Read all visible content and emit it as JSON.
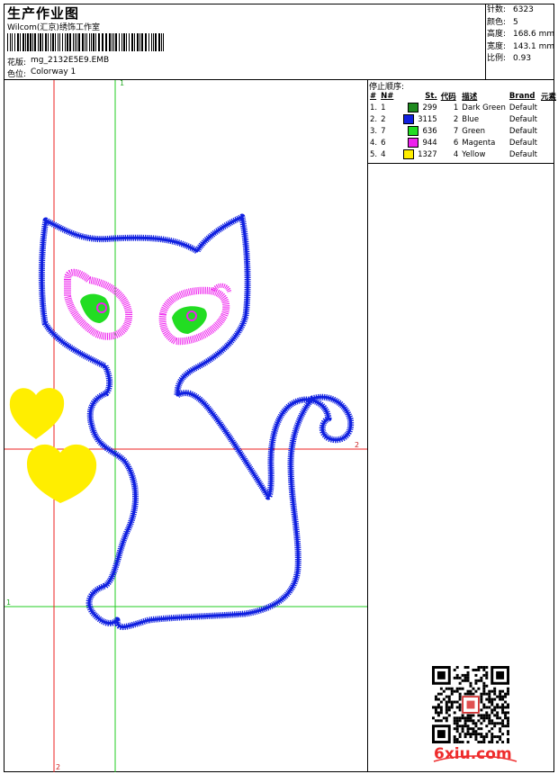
{
  "header": {
    "title": "生产作业图",
    "company": "Wilcom(汇京)绣饰工作室",
    "pattern_label": "花版:",
    "pattern_value": "mg_2132E5E9.EMB",
    "colorway_label": "色位:",
    "colorway_value": "Colorway 1"
  },
  "stats": {
    "stitches_label": "针数:",
    "stitches_value": "6323",
    "colors_label": "颜色:",
    "colors_value": "5",
    "height_label": "高度:",
    "height_value": "168.6 mm",
    "width_label": "宽度:",
    "width_value": "143.1 mm",
    "scale_label": "比例:",
    "scale_value": "0.93"
  },
  "stop_sequence": {
    "title": "停止顺序:",
    "headers": [
      "#",
      "N#",
      "St.",
      "代码",
      "描述",
      "Brand",
      "元素"
    ],
    "rows": [
      {
        "idx": "1.",
        "n": "1",
        "color": "#1f8a1f",
        "st": "299",
        "code": "1",
        "desc": "Dark Green",
        "brand": "Default"
      },
      {
        "idx": "2.",
        "n": "2",
        "color": "#1020e0",
        "st": "3115",
        "code": "2",
        "desc": "Blue",
        "brand": "Default"
      },
      {
        "idx": "3.",
        "n": "7",
        "color": "#22dd22",
        "st": "636",
        "code": "7",
        "desc": "Green",
        "brand": "Default"
      },
      {
        "idx": "4.",
        "n": "6",
        "color": "#ee22ee",
        "st": "944",
        "code": "6",
        "desc": "Magenta",
        "brand": "Default"
      },
      {
        "idx": "5.",
        "n": "4",
        "color": "#ffee00",
        "st": "1327",
        "code": "4",
        "desc": "Yellow",
        "brand": "Default"
      }
    ]
  },
  "canvas": {
    "marker_top": "1",
    "marker_left": "1",
    "marker_bottom": "2",
    "marker_right": "2"
  },
  "watermark": "6xiu.com"
}
